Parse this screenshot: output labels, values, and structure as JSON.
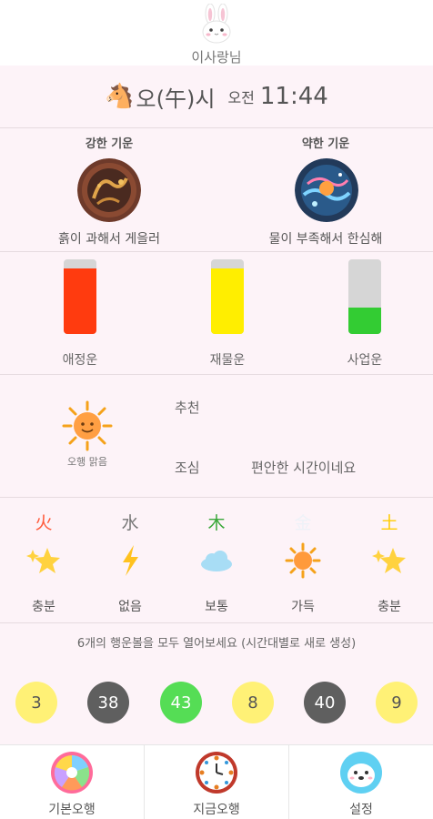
{
  "header": {
    "avatar_icon": "rabbit-face-icon",
    "user_name": "이사랑님"
  },
  "time": {
    "zodiac_icon": "horse-face-icon",
    "hour_name": "오(午)시",
    "ampm": "오전",
    "clock": "11:44"
  },
  "energy": {
    "strong": {
      "title": "강한 기운",
      "description": "흙이 과해서 게을러"
    },
    "weak": {
      "title": "약한 기운",
      "description": "물이 부족해서 한심해"
    }
  },
  "fortune_gauges": [
    {
      "label": "애정운",
      "level": 0.88,
      "color": "#ff3b0f"
    },
    {
      "label": "재물운",
      "level": 0.88,
      "color": "#ffee00"
    },
    {
      "label": "사업운",
      "level": 0.35,
      "color": "#33cc33"
    }
  ],
  "weather": {
    "icon": "sun-face-icon",
    "caption": "오행 맑음"
  },
  "advice": {
    "recommend_label": "추천",
    "recommend_value": "",
    "caution_label": "조심",
    "caution_value": "편안한 시간이네요"
  },
  "elements": [
    {
      "char": "火",
      "color": "#ff5a3a",
      "icon": "sparkle-star-icon",
      "status": "충분"
    },
    {
      "char": "水",
      "color": "#777777",
      "icon": "lightning-icon",
      "status": "없음"
    },
    {
      "char": "木",
      "color": "#3aa83a",
      "icon": "cloud-icon",
      "status": "보통"
    },
    {
      "char": "金",
      "color": "#eef2f8",
      "icon": "sun-icon",
      "status": "가득"
    },
    {
      "char": "土",
      "color": "#ffcc00",
      "icon": "sparkle-star-icon",
      "status": "충분"
    }
  ],
  "lucky": {
    "message": "6개의 행운볼을 모두 열어보세요 (시간대별로 새로 생성)",
    "balls": [
      {
        "number": "3",
        "color": "#fff176",
        "text_color": "#555555"
      },
      {
        "number": "38",
        "color": "#5f5f5f",
        "text_color": "#ffffff"
      },
      {
        "number": "43",
        "color": "#55dd55",
        "text_color": "#ffffff"
      },
      {
        "number": "8",
        "color": "#fff176",
        "text_color": "#555555"
      },
      {
        "number": "40",
        "color": "#5f5f5f",
        "text_color": "#ffffff"
      },
      {
        "number": "9",
        "color": "#fff176",
        "text_color": "#555555"
      }
    ]
  },
  "tabs": [
    {
      "label": "기본오행",
      "icon": "five-elements-wheel-icon"
    },
    {
      "label": "지금오행",
      "icon": "clock-wheel-icon"
    },
    {
      "label": "설정",
      "icon": "seal-face-icon"
    }
  ]
}
